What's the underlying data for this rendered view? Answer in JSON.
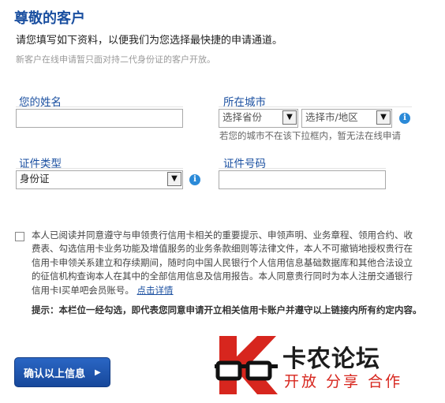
{
  "header": {
    "title": "尊敬的客户",
    "intro": "请您填写如下资料，以便我们为您选择最快捷的申请通道。",
    "note": "新客户在线申请暂只面对持二代身份证的客户开放。"
  },
  "form": {
    "name_label": "您的姓名",
    "name_value": "",
    "city_label": "所在城市",
    "province_placeholder": "选择省份",
    "city_placeholder": "选择市/地区",
    "city_warning": "若您的城市不在该下拉框内，暂无法在线申请",
    "id_type_label": "证件类型",
    "id_type_value": "身份证",
    "id_number_label": "证件号码",
    "id_number_value": ""
  },
  "agreement": {
    "checked": false,
    "text": "本人已阅读并同意遵守与申领贵行信用卡相关的重要提示、申领声明、业务章程、领用合约、收费表、勾选信用卡业务功能及增值服务的业务条款细则等法律文件，本人不可撤销地授权贵行在信用卡申领关系建立和存续期间，随时向中国人民银行个人信用信息基础数据库和其他合法设立的征信机构查询本人在其中的全部信用信息及信用报告。本人同意贵行同时为本人注册交通银行信用卡I买单吧会员账号。",
    "link_label": "点击详情",
    "tip": "提示：本栏位一经勾选，即代表您同意申请开立相关信用卡账户并遵守以上链接内所有约定内容。"
  },
  "actions": {
    "confirm_label": "确认以上信息"
  },
  "watermark": {
    "name": "卡农论坛",
    "slogan": "开放 分享 合作"
  },
  "colors": {
    "accent": "#1a4fa0",
    "button": "#1f56b0",
    "info_icon": "#2b8ad8",
    "logo_red": "#d7261e"
  }
}
